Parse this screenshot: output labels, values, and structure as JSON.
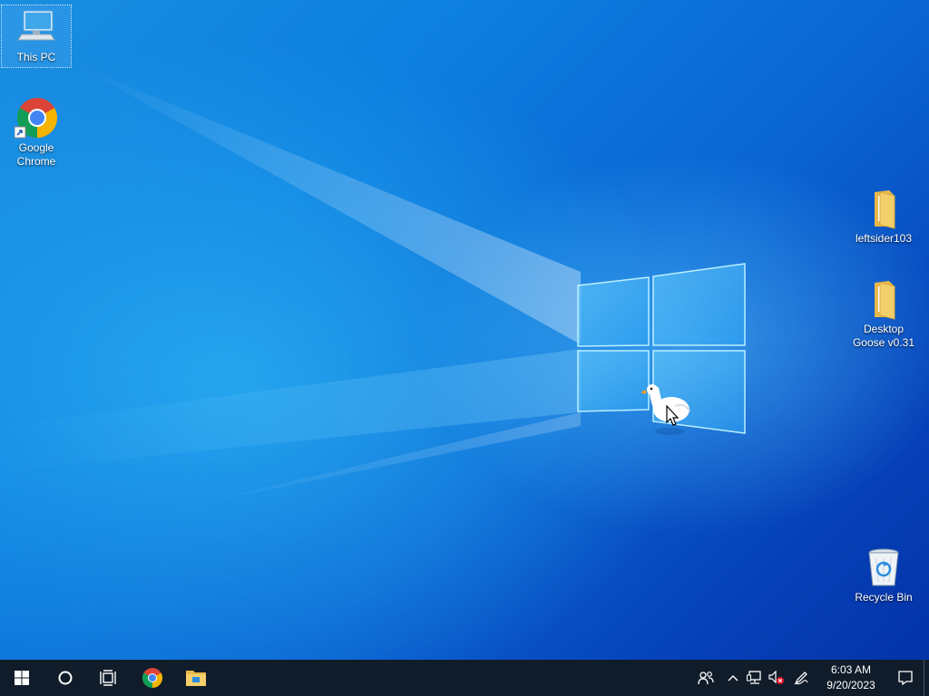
{
  "desktop": {
    "icons": [
      {
        "label": "This PC",
        "icon": "this-pc-icon"
      },
      {
        "label": "Google Chrome",
        "icon": "chrome-shortcut-icon"
      },
      {
        "label": "leftsider103",
        "icon": "folder-icon"
      },
      {
        "label": "Desktop Goose v0.31",
        "icon": "folder-icon"
      },
      {
        "label": "Recycle Bin",
        "icon": "recycle-bin-icon"
      }
    ],
    "overlay": "goose-sprite"
  },
  "taskbar": {
    "start": "windows-logo-icon",
    "search": "cortana-circle-icon",
    "task_view": "task-view-icon",
    "pinned": [
      "chrome-icon",
      "file-explorer-icon"
    ],
    "tray": [
      "people-icon",
      "chevron-up-icon",
      "network-icon",
      "volume-muted-icon",
      "pen-workspace-icon"
    ],
    "clock": {
      "time": "6:03 AM",
      "date": "9/20/2023"
    },
    "notifications": "action-center-icon"
  },
  "colors": {
    "wallpaper_light": "#2aa8f0",
    "wallpaper_dark": "#0433a8",
    "taskbar": "#101c2a",
    "chrome_red": "#db4437",
    "chrome_green": "#0f9d58",
    "chrome_yellow": "#f4b400",
    "chrome_blue": "#4285f4",
    "folder": "#f3cf6b"
  }
}
